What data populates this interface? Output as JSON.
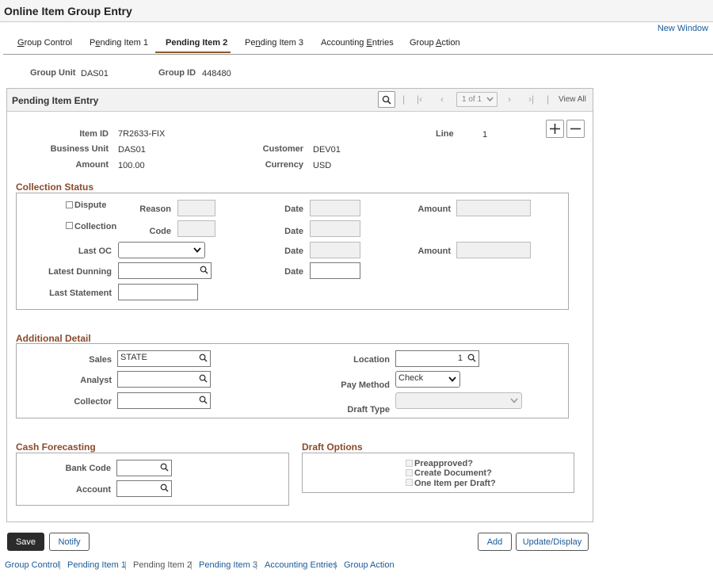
{
  "header": {
    "title": "Online Item Group Entry",
    "new_window": "New Window"
  },
  "tabs": [
    {
      "label_pre": "",
      "label_u": "G",
      "label_post": "roup Control"
    },
    {
      "label_pre": "P",
      "label_u": "e",
      "label_post": "nding Item 1"
    },
    {
      "label_pre": "Pending Item 2",
      "label_u": "",
      "label_post": ""
    },
    {
      "label_pre": "Pe",
      "label_u": "n",
      "label_post": "ding Item 3"
    },
    {
      "label_pre": "Accounting ",
      "label_u": "E",
      "label_post": "ntries"
    },
    {
      "label_pre": "Group ",
      "label_u": "A",
      "label_post": "ction"
    }
  ],
  "group": {
    "unit_label": "Group Unit",
    "unit_value": "DAS01",
    "id_label": "Group ID",
    "id_value": "448480"
  },
  "panel": {
    "title": "Pending Item Entry",
    "pager": "1 of 1",
    "view_all": "View All",
    "sep": "|"
  },
  "item": {
    "item_id_label": "Item ID",
    "item_id": "7R2633-FIX",
    "line_label": "Line",
    "line": "1",
    "bu_label": "Business Unit",
    "bu": "DAS01",
    "customer_label": "Customer",
    "customer": "DEV01",
    "amount_label": "Amount",
    "amount": "100.00",
    "currency_label": "Currency",
    "currency": "USD"
  },
  "collection": {
    "title": "Collection Status",
    "dispute": "Dispute",
    "reason": "Reason",
    "date": "Date",
    "amount": "Amount",
    "collection": "Collection",
    "code": "Code",
    "last_oc": "Last OC",
    "latest_dunning": "Latest Dunning",
    "last_statement": "Last Statement"
  },
  "additional": {
    "title": "Additional Detail",
    "sales": "Sales",
    "sales_value": "STATE",
    "location": "Location",
    "location_value": "1",
    "analyst": "Analyst",
    "pay_method": "Pay Method",
    "pay_method_value": "Check",
    "collector": "Collector",
    "draft_type": "Draft Type"
  },
  "cash": {
    "title": "Cash Forecasting",
    "bank_code": "Bank Code",
    "account": "Account"
  },
  "draft": {
    "title": "Draft Options",
    "preapproved": "Preapproved?",
    "create_doc": "Create Document?",
    "one_item": "One Item per Draft?"
  },
  "buttons": {
    "save": "Save",
    "notify": "Notify",
    "add": "Add",
    "update": "Update/Display"
  },
  "footer": {
    "group_control": "Group Control",
    "pending1": "Pending Item 1",
    "pending2": "Pending Item 2",
    "pending3": "Pending Item 3",
    "accounting": "Accounting Entries",
    "group_action": "Group Action",
    "sep": "|"
  }
}
